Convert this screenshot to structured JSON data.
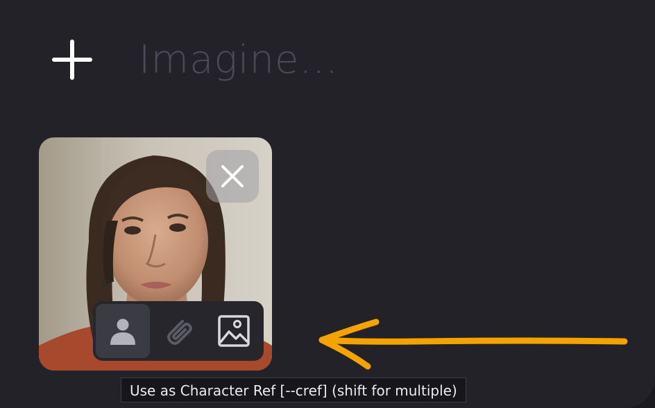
{
  "composer": {
    "add_icon": "plus-icon",
    "prompt_placeholder": "Imagine...",
    "prompt_value": ""
  },
  "attachment": {
    "close_icon": "close-icon",
    "actions": [
      {
        "icon": "person-icon",
        "active": true
      },
      {
        "icon": "paperclip-icon",
        "active": false
      },
      {
        "icon": "image-icon",
        "active": false
      }
    ]
  },
  "tooltip": {
    "text": "Use as Character Ref [--cref] (shift for multiple)"
  },
  "annotation": {
    "color": "#f5a300"
  }
}
